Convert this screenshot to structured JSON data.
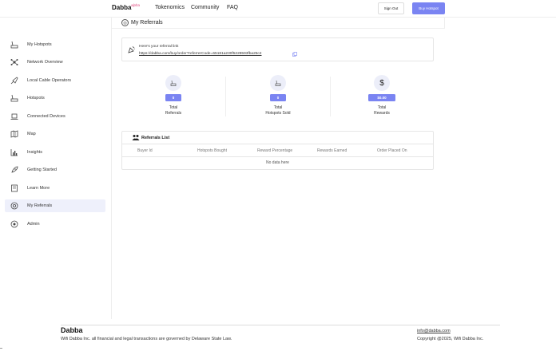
{
  "header": {
    "logo": "Dabba",
    "logo_sup": "alpha",
    "nav": [
      "Tokenomics",
      "Community",
      "FAQ"
    ],
    "sign_out": "Sign Out",
    "buy_hotspot": "Buy Hotspot"
  },
  "sidebar": {
    "items": [
      {
        "label": "My Hotspots",
        "icon": "hotspot-icon"
      },
      {
        "label": "Network Overview",
        "icon": "network-icon"
      },
      {
        "label": "Local Cable Operators",
        "icon": "cable-icon"
      },
      {
        "label": "Hotspots",
        "icon": "hotspot-icon"
      },
      {
        "label": "Connected Devices",
        "icon": "laptop-icon"
      },
      {
        "label": "Map",
        "icon": "map-icon"
      },
      {
        "label": "Insights",
        "icon": "chart-icon"
      },
      {
        "label": "Getting Started",
        "icon": "rocket-icon"
      },
      {
        "label": "Learn More",
        "icon": "book-icon"
      },
      {
        "label": "My Referrals",
        "icon": "referral-icon"
      },
      {
        "label": "Admin",
        "icon": "admin-icon"
      }
    ],
    "active_index": 9
  },
  "page": {
    "title": "My Referrals",
    "referral_caption": "Here's your referral link",
    "referral_link": "https://dabba.com/buy/order?referrerCode=65181a230f5228593fba25c2"
  },
  "stats": [
    {
      "value": "0",
      "label_line1": "Total",
      "label_line2": "Referrals",
      "icon": "hotspot-icon"
    },
    {
      "value": "0",
      "label_line1": "Total",
      "label_line2": "Hotspots Sold",
      "icon": "hotspot-icon"
    },
    {
      "value": "$0.00",
      "label_line1": "Total",
      "label_line2": "Rewards",
      "icon": "dollar-icon"
    }
  ],
  "referrals_list": {
    "title": "Referrals List",
    "columns": [
      "Buyer Id",
      "Hotspots Bought",
      "Reward Percentage",
      "Rewards Earned",
      "Order Placed On"
    ],
    "empty": "No data here"
  },
  "footer": {
    "brand": "Dabba",
    "legal": "Wifi Dabba Inc. all financial and legal transactions are governed by Delaware State Law.",
    "email": "info@dabba.com",
    "copyright": "Copyright @2025, Wifi Dabba Inc."
  },
  "colors": {
    "accent": "#7a84f2",
    "active_bg": "#eef0fb",
    "logo_sup": "#e0407a"
  }
}
